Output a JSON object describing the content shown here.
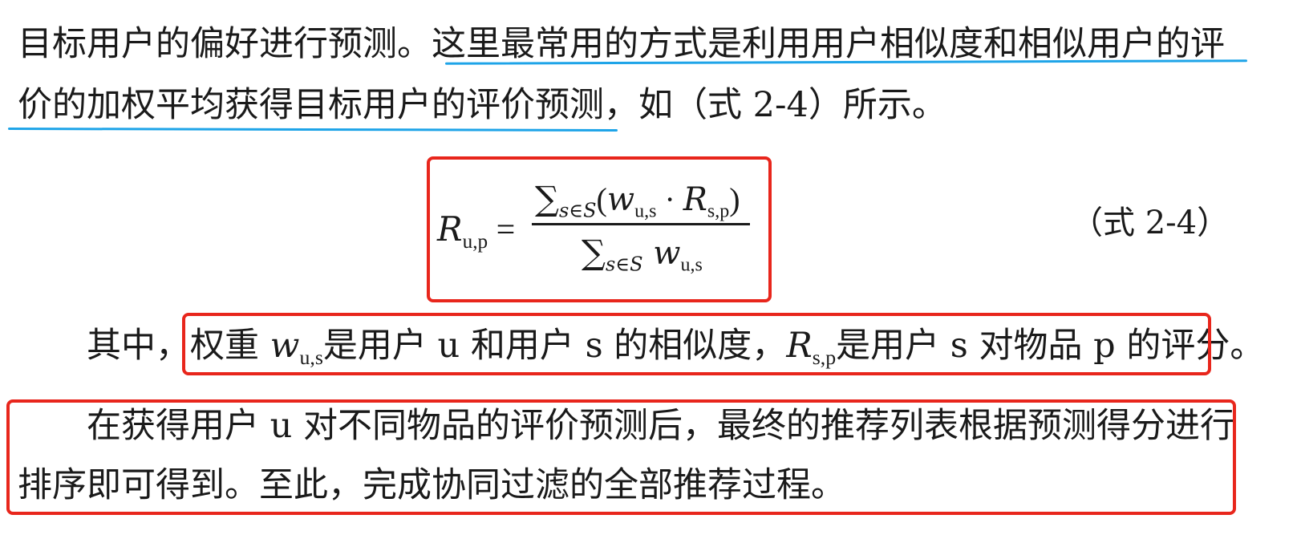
{
  "paragraph1": {
    "line1_plain": "目标用户的偏好进行预测。",
    "line1_underlined": "这里最常用的方式是利用用户相似度和相似用户的评",
    "line2_underlined": "价的加权平均获得目标用户的评价预测，",
    "line2_plain": "如（式 2-4）所示。"
  },
  "equation": {
    "number": "（式 2-4）"
  },
  "paragraph2": {
    "prefix": "其中，",
    "t1": "权重 ",
    "t2": "是用户 u 和用户 s 的相似度，",
    "t3": "是用户 s 对物品 p 的评分",
    "suffix": "。"
  },
  "paragraph3": {
    "line1": "在获得用户 u 对不同物品的评价预测后，最终的推荐列表根据预测得分进行",
    "line2": "排序即可得到。至此，完成协同过滤的全部推荐过程。"
  },
  "colors": {
    "annotation_red": "#e8261c",
    "annotation_blue": "#1ea4e8"
  }
}
